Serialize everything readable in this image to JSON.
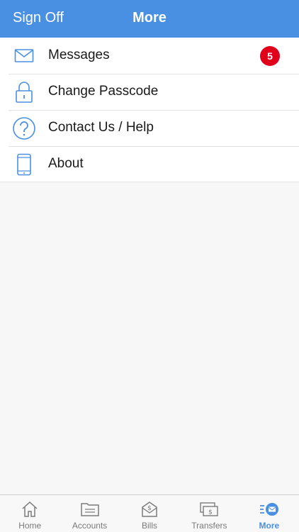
{
  "header": {
    "left_label": "Sign Off",
    "title": "More"
  },
  "menu": {
    "items": [
      {
        "label": "Messages",
        "icon": "envelope-icon",
        "badge": "5"
      },
      {
        "label": "Change Passcode",
        "icon": "lock-icon"
      },
      {
        "label": "Contact Us / Help",
        "icon": "question-icon"
      },
      {
        "label": "About",
        "icon": "phone-icon"
      }
    ]
  },
  "tabbar": {
    "items": [
      {
        "label": "Home",
        "icon": "home-icon"
      },
      {
        "label": "Accounts",
        "icon": "folder-icon"
      },
      {
        "label": "Bills",
        "icon": "bill-envelope-icon"
      },
      {
        "label": "Transfers",
        "icon": "money-transfer-icon"
      },
      {
        "label": "More",
        "icon": "more-mail-icon",
        "active": true
      }
    ]
  },
  "colors": {
    "accent": "#4a90e2",
    "badge": "#e0001b"
  }
}
